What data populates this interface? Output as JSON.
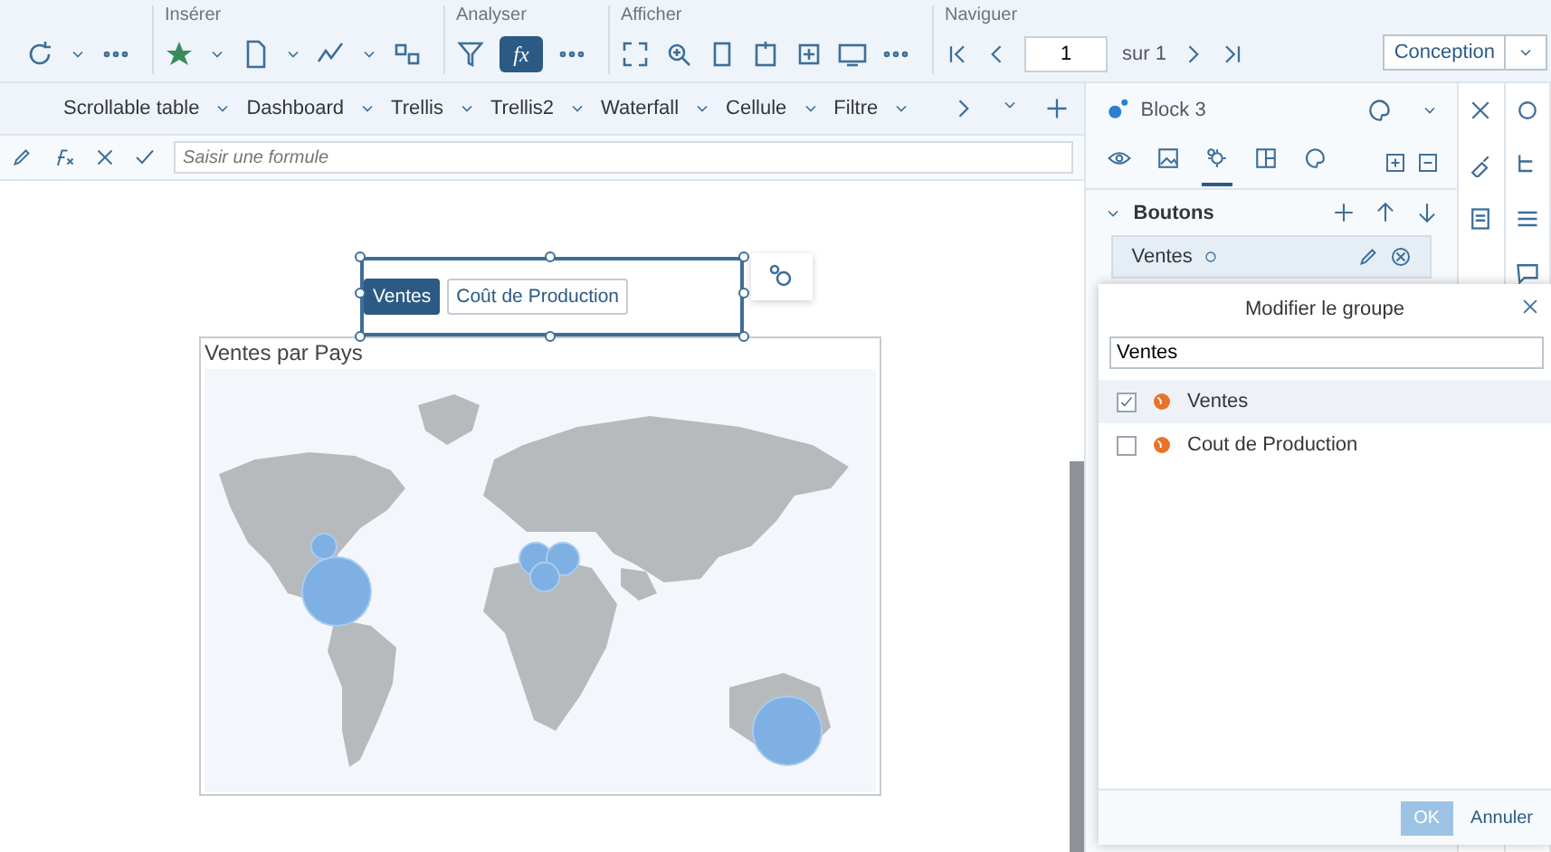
{
  "toolbar": {
    "groups": [
      "Insérer",
      "Analyser",
      "Afficher",
      "Naviguer"
    ],
    "formula_toggle": {
      "label": "fx",
      "selected": true
    },
    "page_field": {
      "value": "1"
    },
    "page_total": "sur 1",
    "mode": "Conception"
  },
  "report_tabs": [
    "Scrollable table",
    "Dashboard",
    "Trellis",
    "Trellis2",
    "Waterfall",
    "Cellule",
    "Filtre"
  ],
  "formula_bar": {
    "placeholder": "Saisir une formule"
  },
  "canvas": {
    "buttons": [
      {
        "label": "Ventes",
        "selected": true
      },
      {
        "label": "Coût de Production",
        "selected": false
      }
    ],
    "map_title": "Ventes par Pays"
  },
  "panel": {
    "title": "Block 3",
    "icon_tabs": [
      {
        "kind": "eye",
        "selected": false
      },
      {
        "kind": "image",
        "selected": false
      },
      {
        "kind": "gear",
        "selected": true
      },
      {
        "kind": "layout",
        "selected": false
      },
      {
        "kind": "palette",
        "selected": false
      }
    ],
    "section": "Boutons",
    "group_item": "Ventes",
    "dialog": {
      "title": "Modifier le groupe",
      "search": "Ventes",
      "options": [
        {
          "label": "Ventes",
          "checked": true
        },
        {
          "label": "Cout de Production",
          "checked": false
        }
      ],
      "ok": "OK",
      "cancel": "Annuler"
    }
  }
}
